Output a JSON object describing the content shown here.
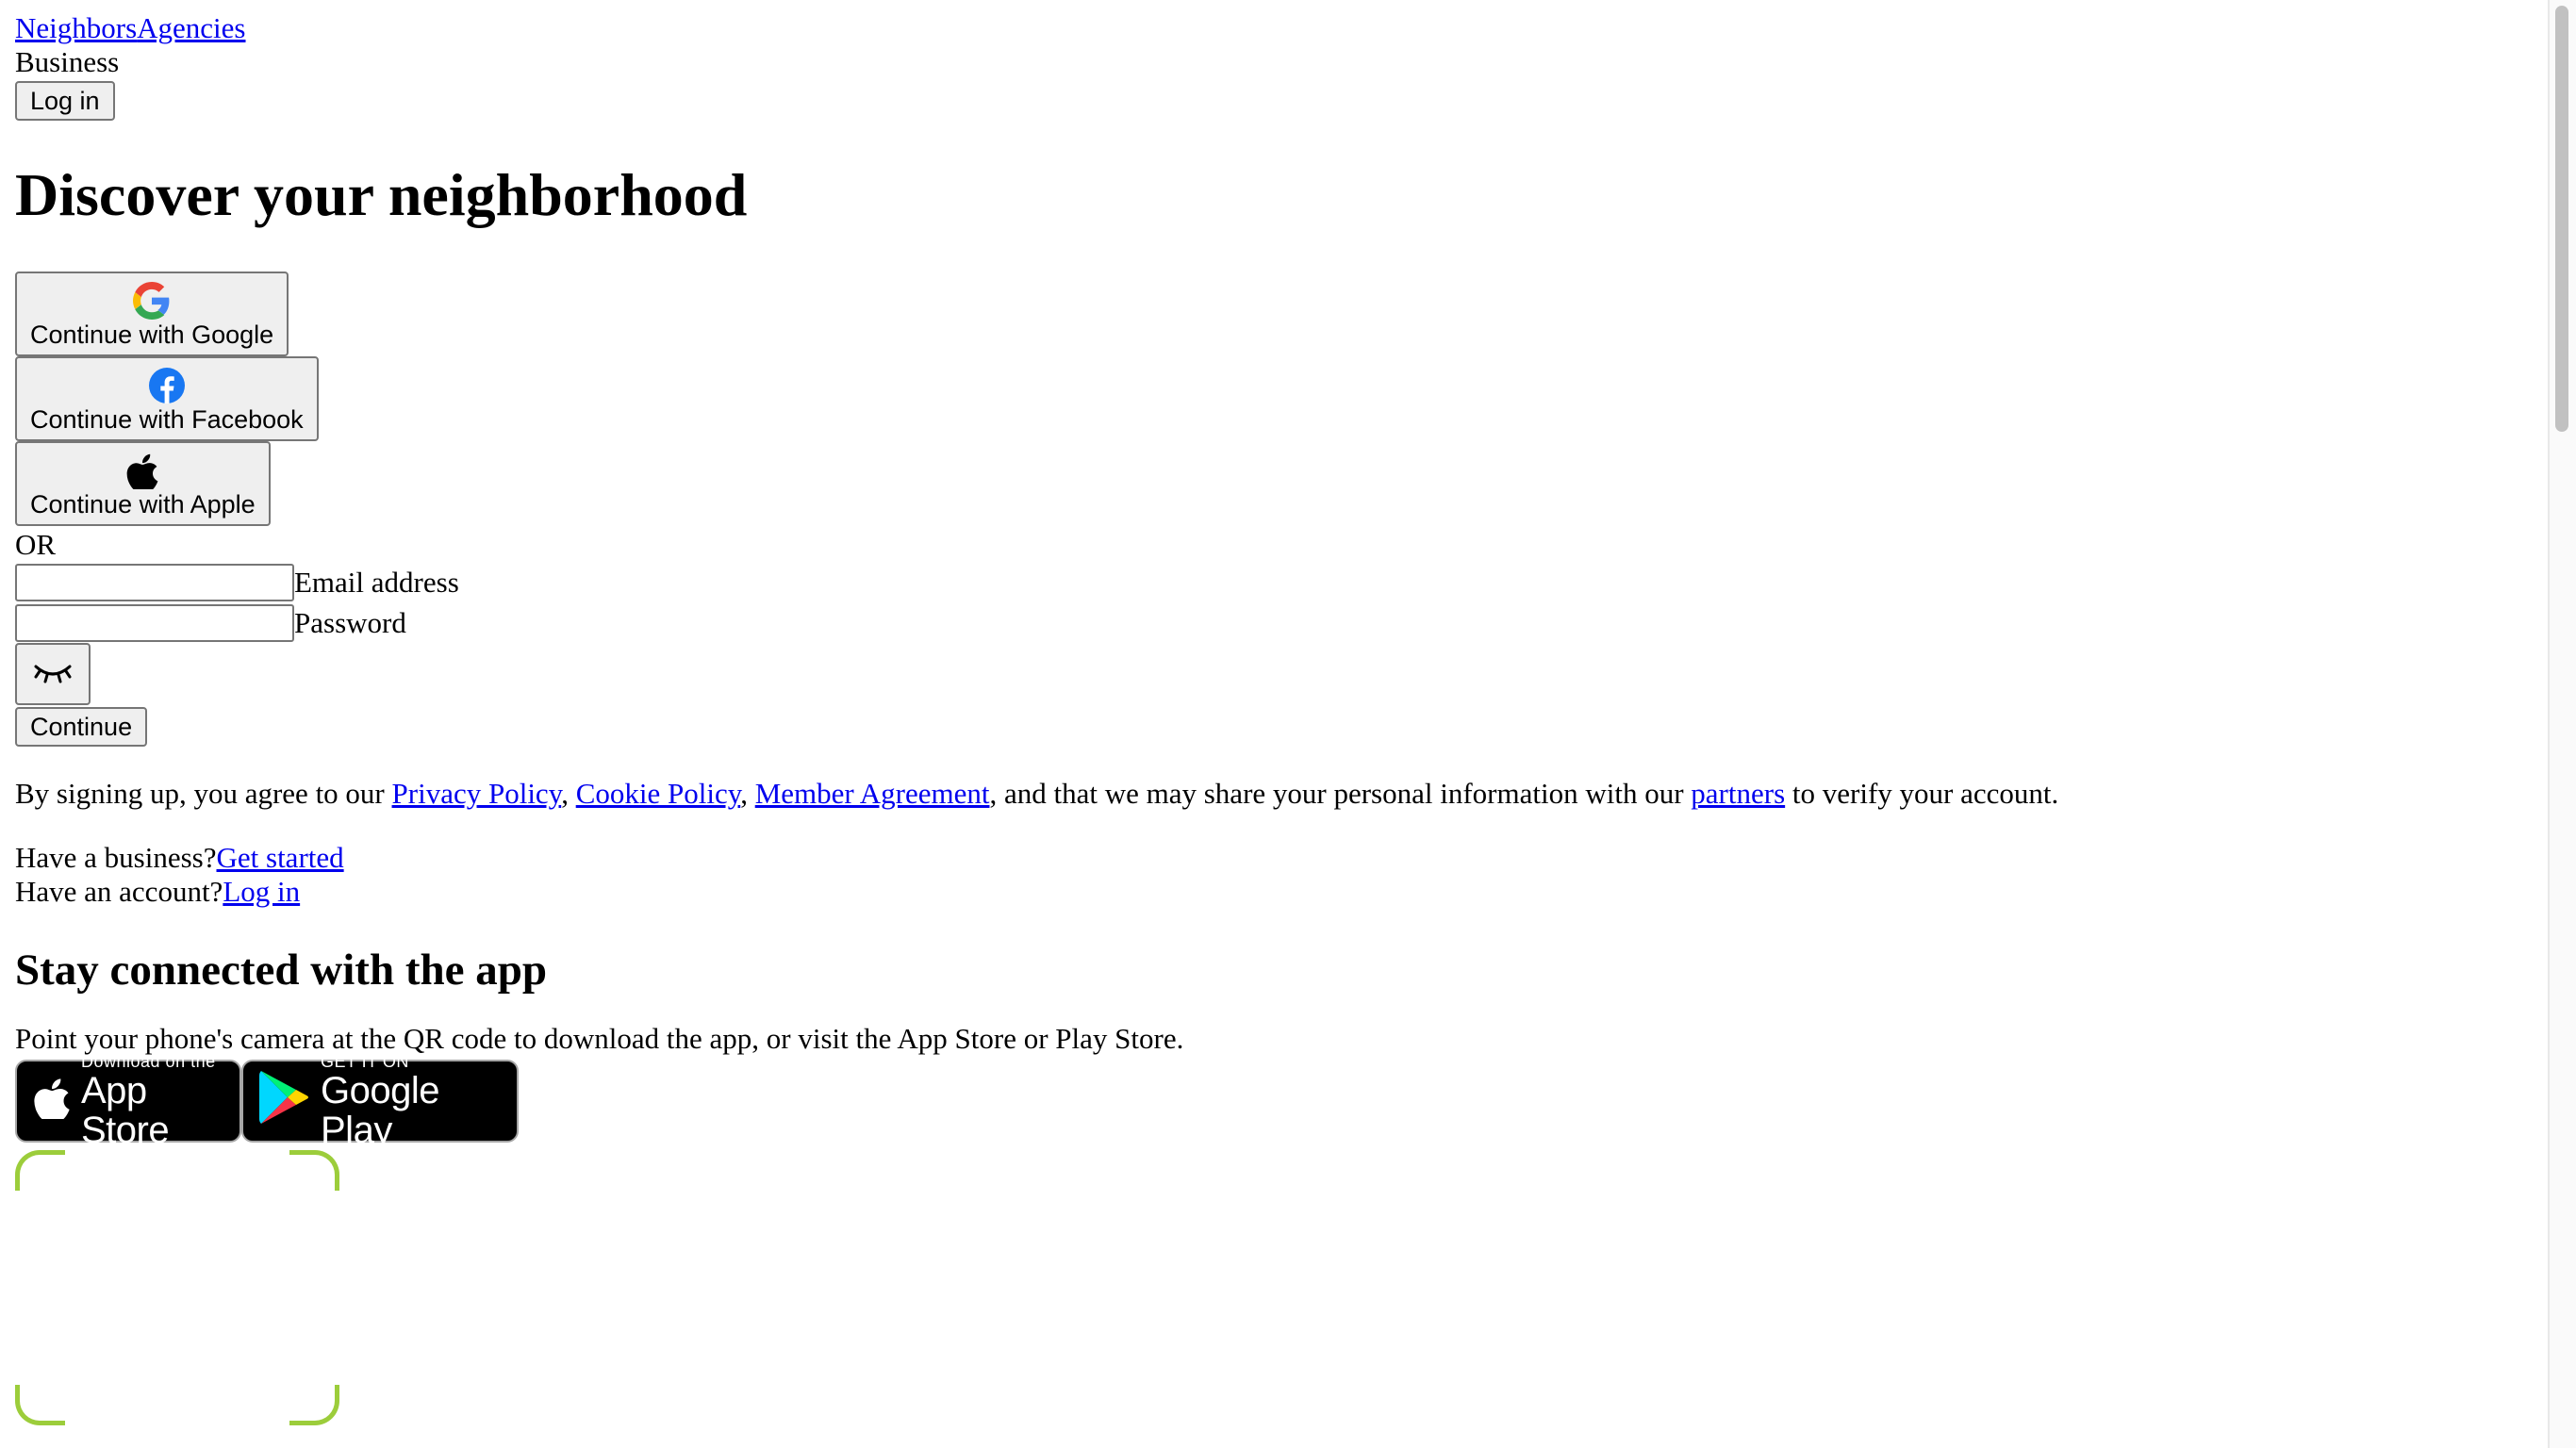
{
  "nav": {
    "neighbors_link": "Neighbors",
    "agencies_link": "Agencies",
    "business_label": "Business",
    "login_button": "Log in"
  },
  "main": {
    "heading": "Discover your neighborhood",
    "social_buttons": {
      "google": "Continue with Google",
      "facebook": "Continue with Facebook",
      "apple": "Continue with Apple"
    },
    "or_divider": "OR",
    "email_label": "Email address",
    "email_value": "",
    "password_label": "Password",
    "password_value": "",
    "continue_button": "Continue"
  },
  "terms": {
    "prefix": "By signing up, you agree to our ",
    "privacy_link": "Privacy Policy",
    "sep1": ", ",
    "cookie_link": "Cookie Policy",
    "sep2": ", ",
    "member_link": "Member Agreement",
    "middle": ", and that we may share your personal information with our ",
    "partners_link": "partners",
    "suffix": " to verify your account."
  },
  "footer_links": {
    "business_prompt": "Have a business?",
    "get_started_link": "Get started",
    "account_prompt": "Have an account?",
    "login_link": "Log in"
  },
  "app_section": {
    "heading": "Stay connected with the app",
    "description": "Point your phone's camera at the QR code to download the app, or visit the App Store or Play Store.",
    "app_store_small": "Download on the",
    "app_store_big": "App Store",
    "play_store_small": "GET IT ON",
    "play_store_big": "Google Play"
  },
  "colors": {
    "link": "#0000ee",
    "qr_frame": "#9ccd3b",
    "badge_bg": "#000000"
  }
}
